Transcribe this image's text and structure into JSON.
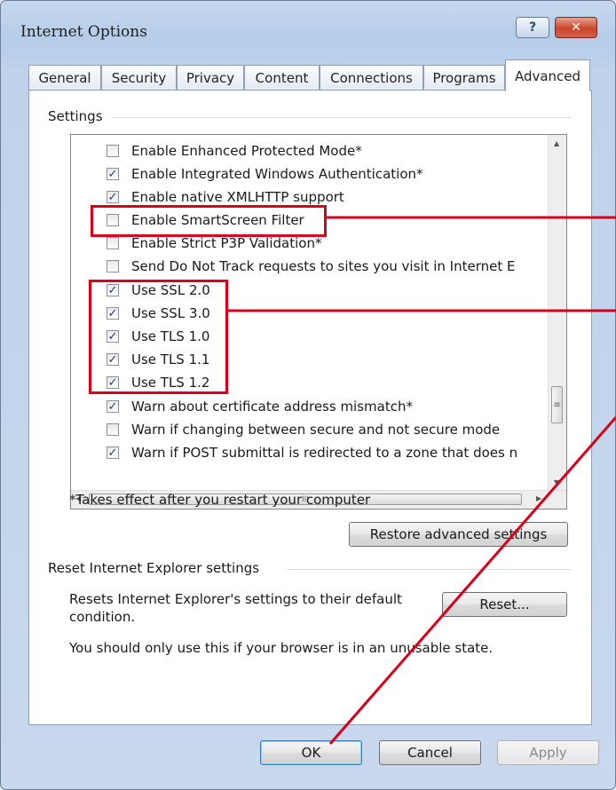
{
  "window": {
    "title": "Internet Options",
    "help_glyph": "?",
    "close_glyph": "✕"
  },
  "tabs": [
    {
      "label": "General"
    },
    {
      "label": "Security"
    },
    {
      "label": "Privacy"
    },
    {
      "label": "Content"
    },
    {
      "label": "Connections"
    },
    {
      "label": "Programs"
    },
    {
      "label": "Advanced",
      "active": true
    }
  ],
  "settings": {
    "group_title": "Settings",
    "items": [
      {
        "label": "Enable Enhanced Protected Mode*",
        "checked": false
      },
      {
        "label": "Enable Integrated Windows Authentication*",
        "checked": true
      },
      {
        "label": "Enable native XMLHTTP support",
        "checked": true
      },
      {
        "label": "Enable SmartScreen Filter",
        "checked": false
      },
      {
        "label": "Enable Strict P3P Validation*",
        "checked": false
      },
      {
        "label": "Send Do Not Track requests to sites you visit in Internet E",
        "checked": false
      },
      {
        "label": "Use SSL 2.0",
        "checked": true
      },
      {
        "label": "Use SSL 3.0",
        "checked": true
      },
      {
        "label": "Use TLS 1.0",
        "checked": true
      },
      {
        "label": "Use TLS 1.1",
        "checked": true
      },
      {
        "label": "Use TLS 1.2",
        "checked": true
      },
      {
        "label": "Warn about certificate address mismatch*",
        "checked": true
      },
      {
        "label": "Warn if changing between secure and not secure mode",
        "checked": false
      },
      {
        "label": "Warn if POST submittal is redirected to a zone that does n",
        "checked": true
      }
    ],
    "note": "*Takes effect after you restart your computer",
    "restore_button": "Restore advanced settings",
    "hscroll_grip": "III",
    "vscroll_grip": "≡"
  },
  "reset": {
    "group_title": "Reset Internet Explorer settings",
    "description_line1": "Resets Internet Explorer's settings to their default",
    "description_line2": "condition.",
    "reset_button": "Reset...",
    "warning": "You should only use this if your browser is in an unusable state."
  },
  "footer": {
    "ok": "OK",
    "cancel": "Cancel",
    "apply": "Apply"
  },
  "colors": {
    "highlight": "#d8001a",
    "window_frame": "#c5d8ee",
    "panel": "#ffffff"
  }
}
